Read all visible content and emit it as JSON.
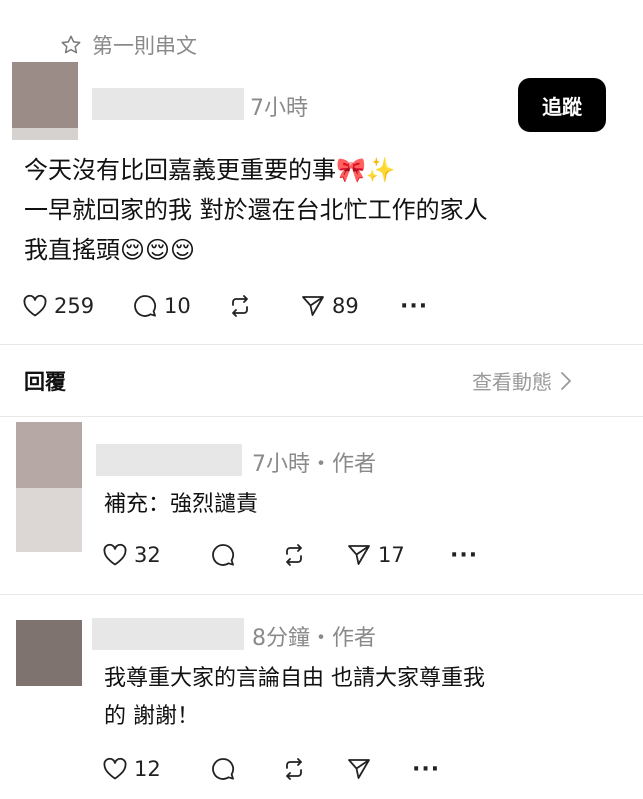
{
  "pinned_label": "第一則串文",
  "post": {
    "time": "7小時",
    "follow_label": "追蹤",
    "lines": [
      "今天沒有比回嘉義更重要的事🎀✨",
      "一早就回家的我 對於還在台北忙工作的家人",
      "我直搖頭😌😌😌"
    ],
    "likes": "259",
    "comments": "10",
    "shares": "89"
  },
  "replies_header": {
    "title": "回覆",
    "view_activity": "查看動態"
  },
  "replies": [
    {
      "meta": "7小時・作者",
      "text_lines": [
        "補充：強烈譴責"
      ],
      "likes": "32",
      "shares": "17"
    },
    {
      "meta": "8分鐘・作者",
      "text_lines": [
        "我尊重大家的言論自由 也請大家尊重我",
        "的 謝謝！"
      ],
      "likes": "12"
    }
  ],
  "icons": {
    "pinned": "star-outline-icon",
    "like": "heart-outline-icon",
    "comment": "speech-bubble-icon",
    "repost": "repost-arrows-icon",
    "share": "paper-plane-icon",
    "more": "more-dots-icon",
    "chevron": "chevron-right-icon"
  },
  "colors": {
    "follow_button_bg": "#000000",
    "muted_text": "#8a8a8a",
    "avatar": "#9c8c87"
  }
}
